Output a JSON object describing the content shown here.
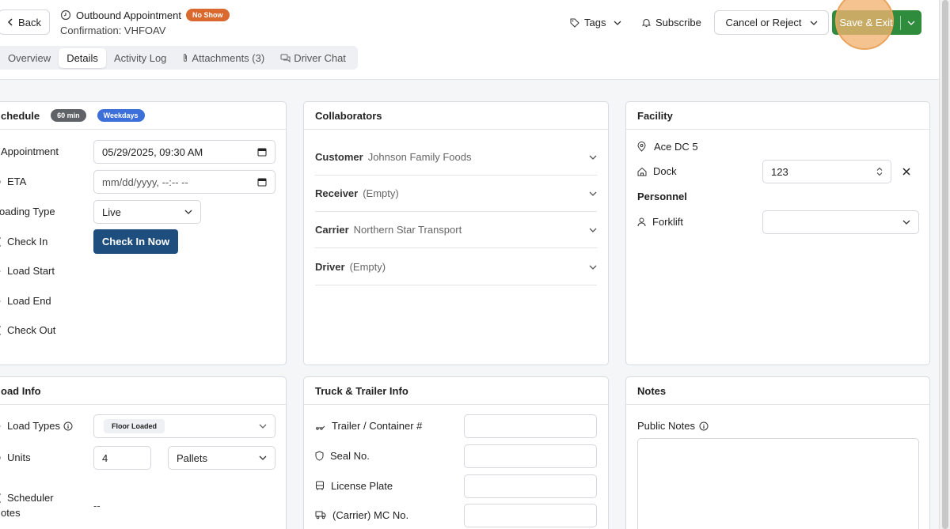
{
  "header": {
    "back_label": "Back",
    "title": "Outbound Appointment",
    "status_badge": "No Show",
    "confirmation": "Confirmation: VHFOAV",
    "tags_label": "Tags",
    "subscribe_label": "Subscribe",
    "cancel_label": "Cancel or Reject",
    "save_label": "Save & Exit"
  },
  "tabs": [
    {
      "label": "Overview"
    },
    {
      "label": "Details"
    },
    {
      "label": "Activity Log"
    },
    {
      "label": "Attachments (3)"
    },
    {
      "label": "Driver Chat"
    }
  ],
  "schedule": {
    "title": "chedule",
    "duration_badge": "60 min",
    "days_badge": "Weekdays",
    "appointment_label": "Appointment",
    "appointment_value": "05/29/2025, 09:30  AM",
    "eta_label": "ETA",
    "eta_placeholder": "mm/dd/yyyy, --:-- --",
    "loading_type_label": "oading Type",
    "loading_type_value": "Live",
    "check_in_label": "Check In",
    "check_in_button": "Check In Now",
    "load_start_label": "Load Start",
    "load_end_label": "Load End",
    "check_out_label": "Check Out"
  },
  "collaborators": {
    "title": "Collaborators",
    "rows": [
      {
        "key": "Customer",
        "value": "Johnson Family Foods"
      },
      {
        "key": "Receiver",
        "value": "(Empty)"
      },
      {
        "key": "Carrier",
        "value": "Northern Star Transport"
      },
      {
        "key": "Driver",
        "value": "(Empty)"
      }
    ]
  },
  "facility": {
    "title": "Facility",
    "location": "Ace DC 5",
    "dock_label": "Dock",
    "dock_value": "123",
    "personnel_label": "Personnel",
    "forklift_label": "Forklift",
    "forklift_value": ""
  },
  "load_info": {
    "title": "oad Info",
    "load_types_label": "Load Types",
    "load_types_value": "Floor Loaded",
    "units_label": "Units",
    "units_value": "4",
    "units_type": "Pallets",
    "scheduler_notes_label_1": "Scheduler",
    "scheduler_notes_label_2": "otes",
    "scheduler_notes_value": "--"
  },
  "truck_trailer": {
    "title": "Truck & Trailer Info",
    "trailer_label": "Trailer / Container #",
    "seal_label": "Seal No.",
    "plate_label": "License Plate",
    "mc_label": "(Carrier) MC No."
  },
  "notes": {
    "title": "Notes",
    "public_notes_label": "Public Notes"
  },
  "colors": {
    "save_green": "#2f8c3c",
    "no_show_orange": "#d9692e",
    "check_in_blue": "#1e4e7e",
    "weekdays_blue": "#3c6fd9",
    "highlight": "#f2b270"
  },
  "icons": [
    "back-chevron-icon",
    "clock-refresh-icon",
    "tag-icon",
    "chevron-down-icon",
    "bell-icon",
    "paperclip-icon",
    "chat-icon",
    "calendar-icon",
    "map-pin-icon",
    "home-icon",
    "stepper-icon",
    "close-icon",
    "user-icon",
    "info-icon",
    "trailer-icon",
    "shield-icon",
    "bus-icon",
    "truck-icon"
  ]
}
